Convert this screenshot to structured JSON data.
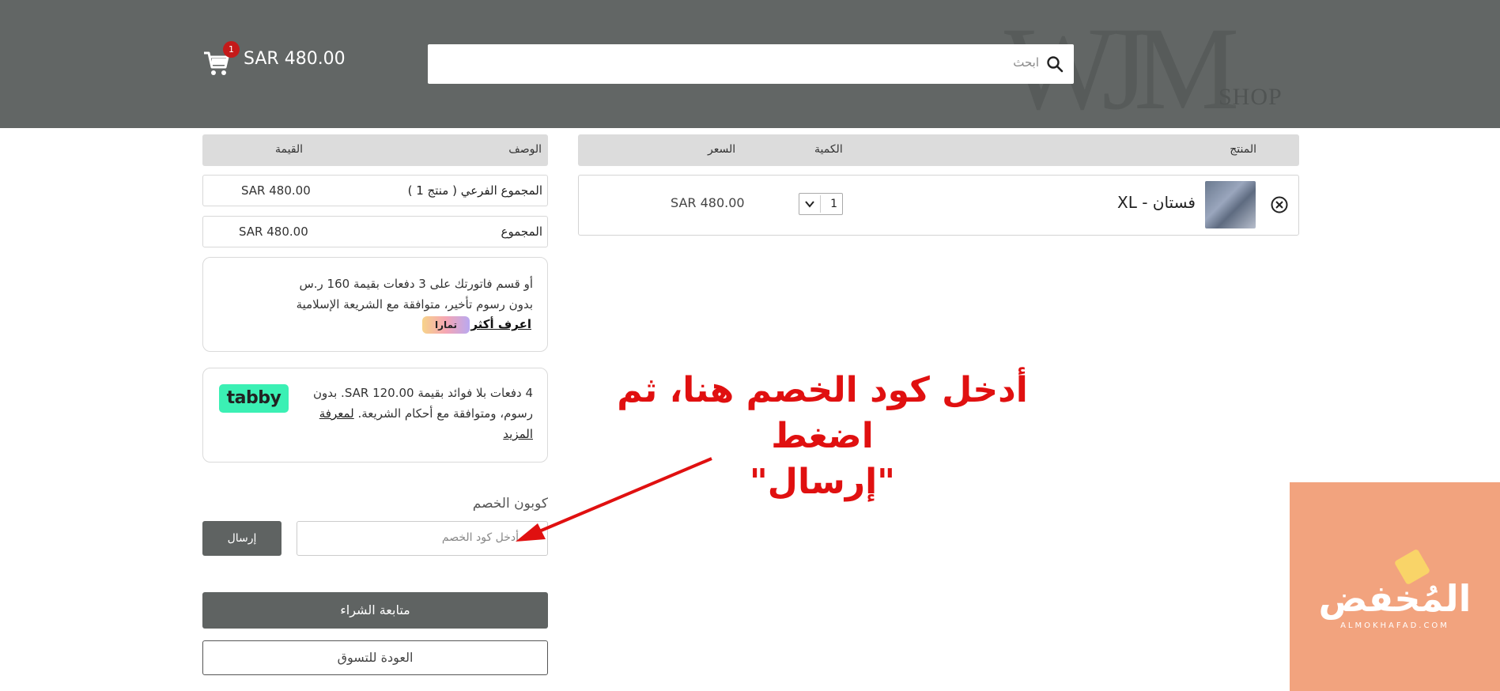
{
  "header": {
    "logo_text": "WJM",
    "logo_sub": "SHOP",
    "search_placeholder": "ابحث",
    "cart_count": "1",
    "cart_total": "SAR 480.00"
  },
  "summary": {
    "col_desc": "الوصف",
    "col_value": "القيمة",
    "subtotal_label": "المجموع الفرعي ( منتج 1 )",
    "subtotal_value": "SAR 480.00",
    "total_label": "المجموع",
    "total_value": "SAR 480.00"
  },
  "tamara": {
    "line1": "أو قسم فاتورتك على 3 دفعات بقيمة 160 ر.س",
    "line2": "بدون رسوم تأخير، متوافقة مع الشريعة الإسلامية",
    "learn_more": "اعرف أكثر",
    "logo": "تمارا"
  },
  "tabby": {
    "text": "4 دفعات بلا فوائد بقيمة SAR 120.00. بدون رسوم، ومتوافقة مع أحكام الشريعة.",
    "link": "لمعرفة المزيد",
    "logo": "tabby"
  },
  "coupon": {
    "title": "كوبون الخصم",
    "placeholder": "أدخل كود الخصم",
    "send": "إرسال"
  },
  "buttons": {
    "checkout": "متابعة الشراء",
    "back": "العودة للتسوق"
  },
  "products": {
    "col_product": "المنتج",
    "col_qty": "الكمية",
    "col_price": "السعر",
    "items": [
      {
        "name": "فستان - XL",
        "qty": "1",
        "price": "SAR 480.00"
      }
    ]
  },
  "annotation": {
    "line1": "أدخل كود الخصم هنا، ثم اضغط",
    "line2": "\"إرسال\""
  },
  "watermark": {
    "text": "المُخفض",
    "sub": "ALMOKHAFAD.COM"
  },
  "colors": {
    "header_bg": "#626665",
    "button_bg": "#5f6362",
    "badge": "#c41a1a",
    "annotation": "#e01010",
    "tabby": "#3bf0b4",
    "watermark_bg": "#f2a37e"
  }
}
